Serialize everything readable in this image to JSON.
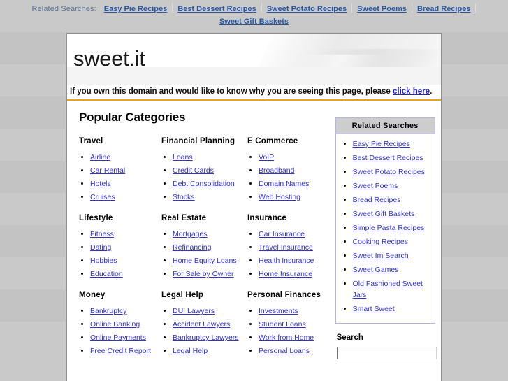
{
  "topbar": {
    "label": "Related Searches:",
    "links": [
      "Easy Pie Recipes",
      "Best Dessert Recipes",
      "Sweet Potato Recipes",
      "Sweet Poems",
      "Bread Recipes",
      "Sweet Gift Baskets"
    ]
  },
  "banner": {
    "domain": "sweet.it"
  },
  "notice": {
    "text_before": "If you own this domain and would like to know why you are seeing this page, please ",
    "link": "click here",
    "text_after": "."
  },
  "main": {
    "heading": "Popular Categories",
    "rows": [
      [
        {
          "title": "Travel",
          "links": [
            "Airline",
            "Car Rental",
            "Hotels",
            "Cruises"
          ]
        },
        {
          "title": "Financial Planning",
          "links": [
            "Loans",
            "Credit Cards",
            "Debt Consolidation",
            "Stocks"
          ]
        },
        {
          "title": "E Commerce",
          "links": [
            "VoIP",
            "Broadband",
            "Domain Names",
            "Web Hosting"
          ]
        }
      ],
      [
        {
          "title": "Lifestyle",
          "links": [
            "Fitness",
            "Dating",
            "Hobbies",
            "Education"
          ]
        },
        {
          "title": "Real Estate",
          "links": [
            "Mortgages",
            "Refinancing",
            "Home Equity Loans",
            "For Sale by Owner"
          ]
        },
        {
          "title": "Insurance",
          "links": [
            "Car Insurance",
            "Travel Insurance",
            "Health Insurance",
            "Home Insurance"
          ]
        }
      ],
      [
        {
          "title": "Money",
          "links": [
            "Bankruptcy",
            "Online Banking",
            "Online Payments",
            "Free Credit Report"
          ]
        },
        {
          "title": "Legal Help",
          "links": [
            "DUI Lawyers",
            "Accident Lawyers",
            "Bankruptcy Lawyers",
            "Legal Help"
          ]
        },
        {
          "title": "Personal Finances",
          "links": [
            "Investments",
            "Student Loans",
            "Work from Home",
            "Personal Loans"
          ]
        }
      ]
    ]
  },
  "sidebar": {
    "heading": "Related Searches",
    "links": [
      "Easy Pie Recipes",
      "Best Dessert Recipes",
      "Sweet Potato Recipes",
      "Sweet Poems",
      "Bread Recipes",
      "Sweet Gift Baskets",
      "Simple Pasta Recipes",
      "Cooking Recipes",
      "Sweet Im Search",
      "Sweet Games",
      "Old Fashioned Sweet Jars",
      "Smart Sweet"
    ],
    "search_label": "Search",
    "search_value": "",
    "search_placeholder": ""
  },
  "colors": {
    "link": "#3333cc",
    "topbar_link": "#2b57a0",
    "accent_rule": "#e8a317",
    "page_bg": "#c6c6c6",
    "panel_border": "#b5b5dd",
    "panel_head_bg": "#cdcdcd"
  }
}
